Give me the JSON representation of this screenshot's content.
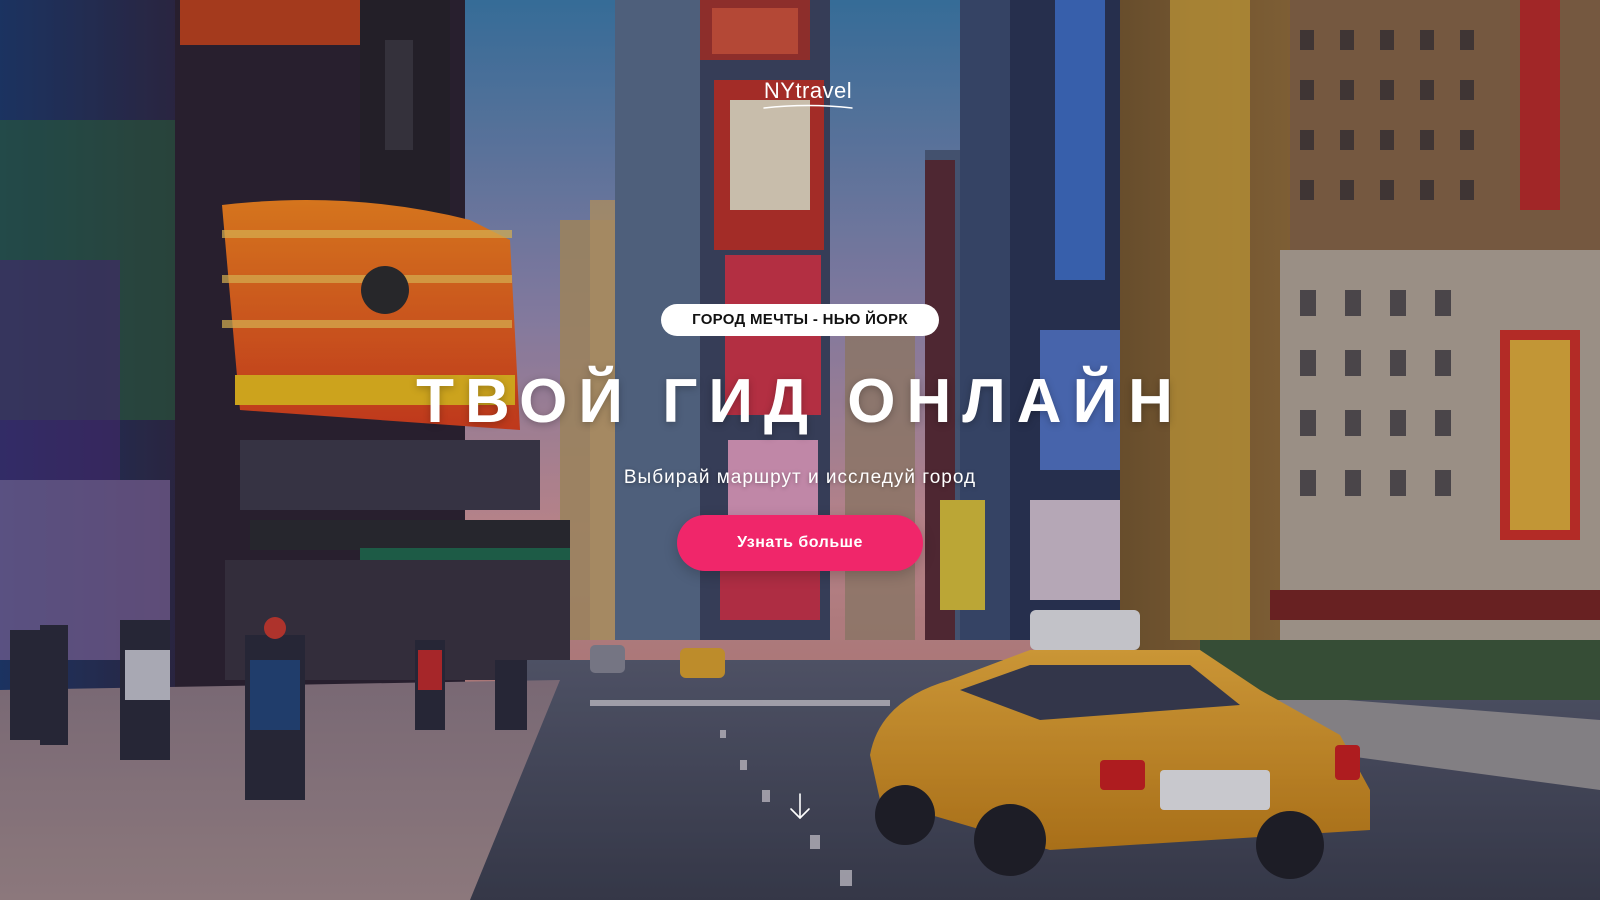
{
  "header": {
    "logo_text": "NYtravel"
  },
  "hero": {
    "badge": "ГОРОД МЕЧТЫ - НЬЮ ЙОРК",
    "title": "ТВОЙ ГИД ОНЛАЙН",
    "subtitle": "Выбирай маршрут и исследуй город",
    "cta_label": "Узнать больше",
    "scroll_icon": "arrow-down-icon"
  },
  "colors": {
    "accent": "#f0266a",
    "badge_bg": "#ffffff",
    "text": "#ffffff"
  }
}
